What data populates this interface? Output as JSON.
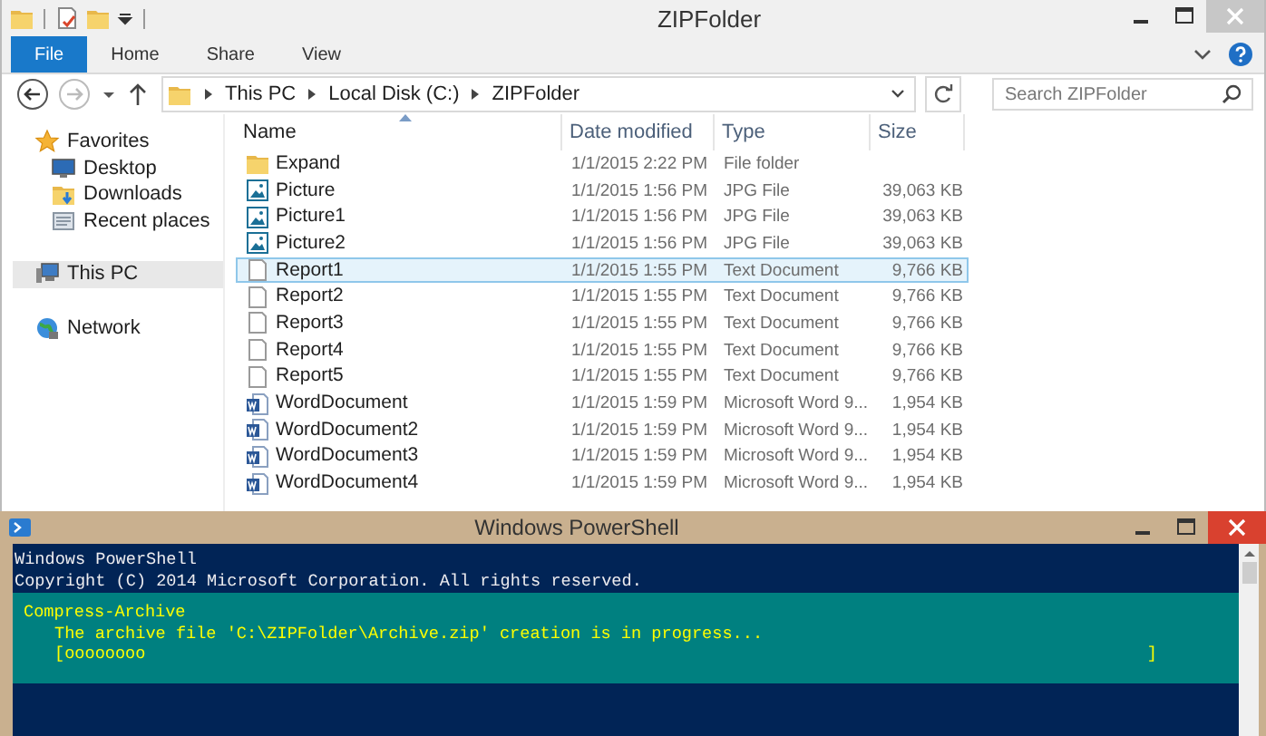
{
  "explorer": {
    "title": "ZIPFolder",
    "ribbon_tabs": [
      {
        "label": "File",
        "kind": "file",
        "selected": false
      },
      {
        "label": "Home",
        "kind": "tab",
        "selected": false
      },
      {
        "label": "Share",
        "kind": "tab",
        "selected": false
      },
      {
        "label": "View",
        "kind": "tab",
        "selected": false
      }
    ],
    "breadcrumbs": [
      "This PC",
      "Local Disk (C:)",
      "ZIPFolder"
    ],
    "search": {
      "placeholder": "Search ZIPFolder"
    },
    "sidebar": {
      "items": [
        {
          "label": "Favorites",
          "kind": "star",
          "selected": false,
          "children": [
            {
              "label": "Desktop",
              "kind": "desktop",
              "selected": false
            },
            {
              "label": "Downloads",
              "kind": "downloads",
              "selected": false
            },
            {
              "label": "Recent places",
              "kind": "recent",
              "selected": false
            }
          ]
        },
        {
          "label": "This PC",
          "kind": "pc",
          "selected": true
        },
        {
          "label": "Network",
          "kind": "network",
          "selected": false
        }
      ]
    },
    "table": {
      "columns": [
        "Name",
        "Date modified",
        "Type",
        "Size"
      ],
      "rows": [
        {
          "kind": "folder",
          "name": "Expand",
          "date": "1/1/2015 2:22 PM",
          "type": "File folder",
          "selected": false
        },
        {
          "kind": "picture",
          "name": "Picture",
          "date": "1/1/2015 1:56 PM",
          "type": "JPG File",
          "size": "39,063 KB",
          "selected": false
        },
        {
          "kind": "picture",
          "name": "Picture1",
          "date": "1/1/2015 1:56 PM",
          "type": "JPG File",
          "size": "39,063 KB",
          "selected": false
        },
        {
          "kind": "picture",
          "name": "Picture2",
          "date": "1/1/2015 1:56 PM",
          "type": "JPG File",
          "size": "39,063 KB",
          "selected": false
        },
        {
          "kind": "text",
          "name": "Report1",
          "date": "1/1/2015 1:55 PM",
          "type": "Text Document",
          "size": "9,766 KB",
          "selected": true
        },
        {
          "kind": "text",
          "name": "Report2",
          "date": "1/1/2015 1:55 PM",
          "type": "Text Document",
          "size": "9,766 KB",
          "selected": false
        },
        {
          "kind": "text",
          "name": "Report3",
          "date": "1/1/2015 1:55 PM",
          "type": "Text Document",
          "size": "9,766 KB",
          "selected": false
        },
        {
          "kind": "text",
          "name": "Report4",
          "date": "1/1/2015 1:55 PM",
          "type": "Text Document",
          "size": "9,766 KB",
          "selected": false
        },
        {
          "kind": "text",
          "name": "Report5",
          "date": "1/1/2015 1:55 PM",
          "type": "Text Document",
          "size": "9,766 KB",
          "selected": false
        },
        {
          "kind": "word",
          "name": "WordDocument",
          "date": "1/1/2015 1:59 PM",
          "type": "Microsoft Word 9...",
          "size": "1,954 KB",
          "selected": false
        },
        {
          "kind": "word",
          "name": "WordDocument2",
          "date": "1/1/2015 1:59 PM",
          "type": "Microsoft Word 9...",
          "size": "1,954 KB",
          "selected": false
        },
        {
          "kind": "word",
          "name": "WordDocument3",
          "date": "1/1/2015 1:59 PM",
          "type": "Microsoft Word 9...",
          "size": "1,954 KB",
          "selected": false
        },
        {
          "kind": "word",
          "name": "WordDocument4",
          "date": "1/1/2015 1:59 PM",
          "type": "Microsoft Word 9...",
          "size": "1,954 KB",
          "selected": false
        }
      ]
    }
  },
  "powershell": {
    "title": "Windows PowerShell",
    "lines": [
      "Windows PowerShell",
      "Copyright (C) 2014 Microsoft Corporation. All rights reserved."
    ],
    "progress": {
      "activity": "Compress-Archive",
      "status": "The archive file 'C:\\ZIPFolder\\Archive.zip' creation is in progress...",
      "bar": "[oooooooo",
      "bar_end": "]"
    }
  }
}
